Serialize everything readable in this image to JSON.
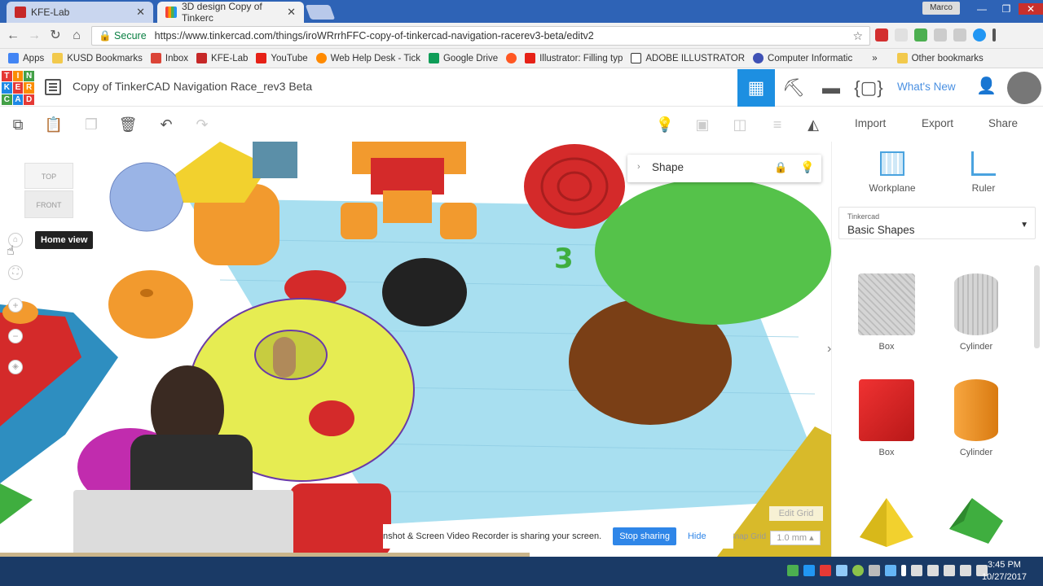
{
  "browser": {
    "tabs": [
      {
        "title": "KFE-Lab",
        "favicon_color": "#c62828"
      },
      {
        "title": "3D design Copy of Tinkerc",
        "favicon_color": "#ff9800"
      }
    ],
    "user_chip": "Marco",
    "address": {
      "secure_label": "Secure",
      "url": "https://www.tinkercad.com/things/iroWRrrhFFC-copy-of-tinkercad-navigation-racerev3-beta/editv2"
    },
    "bookmarks": [
      {
        "label": "Apps",
        "color": "#4285f4"
      },
      {
        "label": "KUSD Bookmarks",
        "color": "#f2c94c"
      },
      {
        "label": "Inbox",
        "color": "#db4437"
      },
      {
        "label": "KFE-Lab",
        "color": "#c62828"
      },
      {
        "label": "YouTube",
        "color": "#e62117"
      },
      {
        "label": "Web Help Desk - Tick",
        "color": "#ff8a00"
      },
      {
        "label": "Google Drive",
        "color": "#0f9d58"
      },
      {
        "label": "",
        "color": "#ff5722"
      },
      {
        "label": "Illustrator: Filling typ",
        "color": "#e62117"
      },
      {
        "label": "ADOBE ILLUSTRATOR",
        "color": "#333333"
      },
      {
        "label": "Computer Informatic",
        "color": "#3f51b5"
      }
    ],
    "bookmarks_more": "»",
    "other_bookmarks": "Other bookmarks"
  },
  "header": {
    "logo_letters": [
      "TIN",
      "KER",
      "CAD"
    ],
    "design_title": "Copy of TinkerCAD Navigation Race_rev3 Beta",
    "whats_new": "What's New"
  },
  "toolbar": {
    "import": "Import",
    "export": "Export",
    "share": "Share"
  },
  "viewcube": {
    "top": "TOP",
    "front": "FRONT"
  },
  "tooltip": {
    "home_view": "Home view"
  },
  "shape_panel": {
    "title": "Shape"
  },
  "right_panel": {
    "workplane": "Workplane",
    "ruler": "Ruler",
    "library_source": "Tinkercad",
    "library_name": "Basic Shapes",
    "shapes": [
      {
        "label": "Box"
      },
      {
        "label": "Cylinder"
      },
      {
        "label": "Box"
      },
      {
        "label": "Cylinder"
      },
      {
        "label": ""
      },
      {
        "label": ""
      }
    ]
  },
  "grid": {
    "edit_grid": "Edit Grid",
    "snap_label": "Snap Grid",
    "snap_value": "1.0 mm"
  },
  "sharing_bar": {
    "message": "nshot & Screen Video Recorder is sharing your screen.",
    "stop": "Stop sharing",
    "hide": "Hide"
  },
  "taskbar": {
    "time": "3:45 PM",
    "date": "10/27/2017"
  },
  "colors": {
    "accent": "#1d8fe1",
    "titlebar": "#2e63b6",
    "grid": "#a8dff0"
  }
}
